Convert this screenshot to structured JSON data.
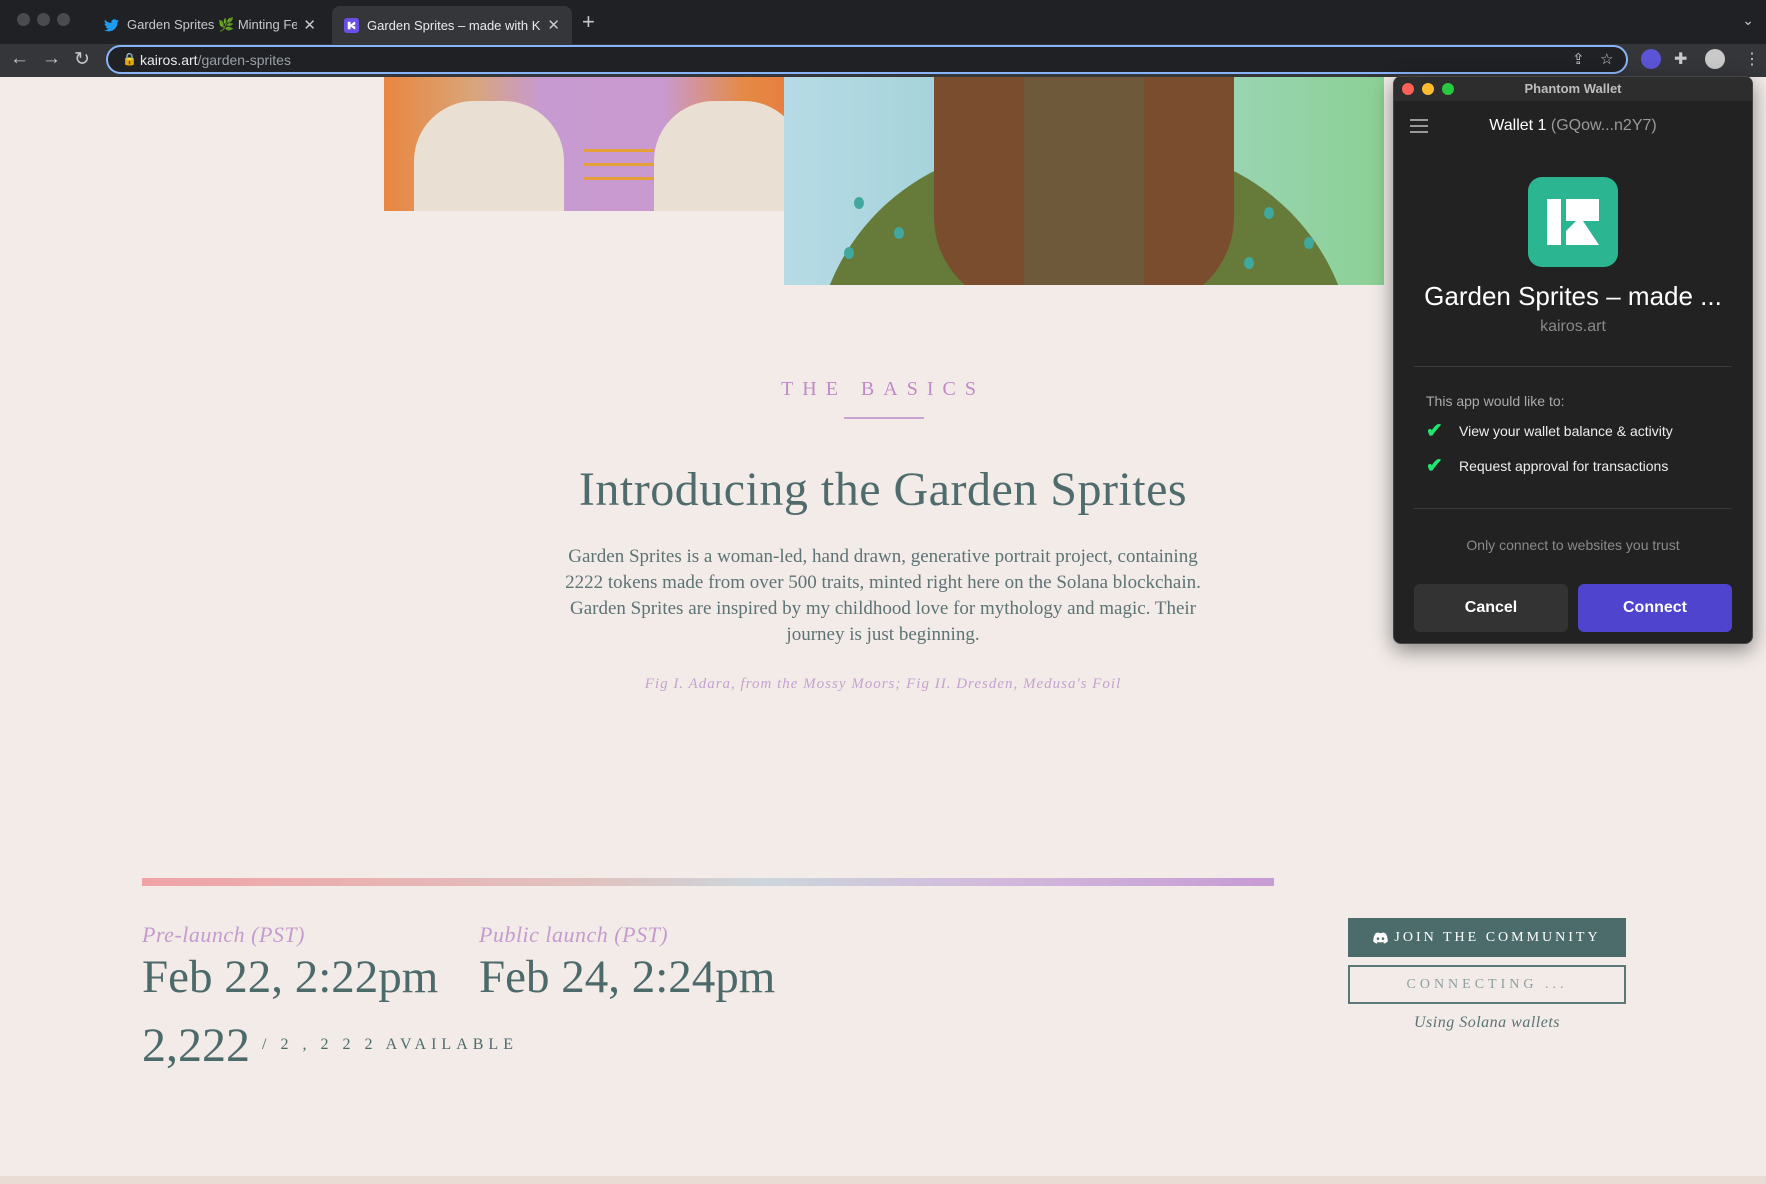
{
  "browser": {
    "tabs": [
      {
        "title": "Garden Sprites 🌿 Minting Feb",
        "icon": "twitter-bird-icon"
      },
      {
        "title": "Garden Sprites – made with Ka",
        "icon": "kairos-logo-icon"
      }
    ],
    "url_host": "kairos.art",
    "url_path": "/garden-sprites"
  },
  "page": {
    "section_eyebrow": "THE BASICS",
    "headline": "Introducing the Garden Sprites",
    "description": "Garden Sprites is a woman-led, hand drawn, generative portrait project, containing 2222 tokens made from over 500 traits, minted right here on the Solana blockchain. Garden Sprites are inspired by my childhood love for mythology and magic. Their journey is just beginning.",
    "caption": "Fig I. Adara, from the Mossy Moors; Fig II. Dresden, Medusa's Foil",
    "prelaunch_label": "Pre-launch (PST)",
    "prelaunch_date": "Feb 22, 2:22pm",
    "public_label": "Public launch (PST)",
    "public_date": "Feb 24, 2:24pm",
    "count": "2,222",
    "available": "/ 2 , 2 2 2  AVAILABLE",
    "join_button": "JOIN THE COMMUNITY",
    "connecting_button": "CONNECTING ...",
    "using_note": "Using Solana wallets"
  },
  "phantom": {
    "window_title": "Phantom Wallet",
    "wallet_name": "Wallet 1",
    "wallet_addr": "(GQow...n2Y7)",
    "app_name": "Garden Sprites – made ...",
    "app_domain": "kairos.art",
    "would_like": "This app would like to:",
    "permissions": [
      "View your wallet balance & activity",
      "Request approval for transactions"
    ],
    "trust_note": "Only connect to websites you trust",
    "cancel_label": "Cancel",
    "connect_label": "Connect"
  },
  "colors": {
    "accent_purple": "#c08ac9",
    "heading_teal": "#4f6b6c",
    "phantom_connect": "#4e44ce",
    "app_logo_green": "#2bb591"
  }
}
